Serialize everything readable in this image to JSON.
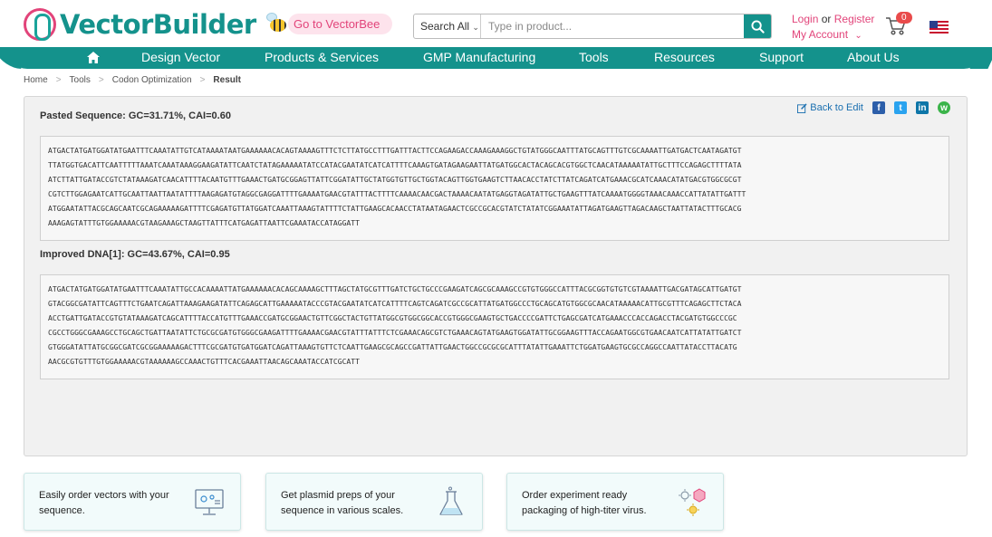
{
  "header": {
    "brand": "VectorBuilder",
    "vectorbee_label": "Go to VectorBee",
    "search_scope": "Search All",
    "search_placeholder": "Type in product...",
    "login": "Login",
    "or": "or",
    "register": "Register",
    "my_account": "My Account",
    "cart_count": "0"
  },
  "nav": {
    "items": [
      "Design Vector",
      "Products & Services",
      "GMP Manufacturing",
      "Tools",
      "Resources",
      "Support",
      "About Us"
    ]
  },
  "breadcrumb": {
    "items": [
      "Home",
      "Tools",
      "Codon Optimization"
    ],
    "current": "Result"
  },
  "result": {
    "back_to_edit": "Back to Edit",
    "pasted_title": "Pasted Sequence: GC=31.71%, CAI=0.60",
    "pasted_sequence": "ATGACTATGATGGATATGAATTTCAAATATTGTCATAAAATAATGAAAAAACACAGTAAAAGTTTCTCTTATGCCTTTGATTTACTTCCAGAAGACCAAAGAAAGGCTGTATGGGCAATTTATGCAGTTTGTCGCAAAATTGATGACTCAATAGATGT\nTTATGGTGACATTCAATTTTTAAATCAAATAAAGGAAGATATTCAATCTATAGAAAAATATCCATACGAATATCATCATTTTCAAAGTGATAGAAGAATTATGATGGCACTACAGCACGTGGCTCAACATAAAAATATTGCTTTCCAGAGCTTTTATA\nATCTTATTGATACCGTCTATAAAGATCAACATTTTACAATGTTTGAAACTGATGCGGAGTTATTCGGATATTGCTATGGTGTTGCTGGTACAGTTGGTGAAGTCTTAACACCTATCTTATCAGATCATGAAACGCATCAAACATATGACGTGGCGCGT\nCGTCTTGGAGAATCATTGCAATTAATTAATATTTTAAGAGATGTAGGCGAGGATTTTGAAAATGAACGTATTTACTTTTCAAAACAACGACTAAAACAATATGAGGTAGATATTGCTGAAGTTTATCAAAATGGGGTAAACAAACCATTATATTGATTT\nATGGAATATTACGCAGCAATCGCAGAAAAAGATTTTCGAGATGTTATGGATCAAATTAAAGTATTTTCTATTGAAGCACAACCTATAATAGAACTCGCCGCACGTATCTATATCGGAAATATTAGATGAAGTTAGACAAGCTAATTATACTTTGCACG\nAAAGAGTATTTGTGGAAAAACGTAAGAAAGCTAAGTTATTTCATGAGATTAATTCGAAATACCATAGGATT",
    "improved_title": "Improved DNA[1]: GC=43.67%, CAI=0.95",
    "improved_sequence": "ATGACTATGATGGATATGAATTTCAAATATTGCCACAAAATTATGAAAAAACACAGCAAAAGCTTTAGCTATGCGTTTGATCTGCTGCCCGAAGATCAGCGCAAAGCCGTGTGGGCCATTTACGCGGTGTGTCGTAAAATTGACGATAGCATTGATGT\nGTACGGCGATATTCAGTTTCTGAATCAGATTAAAGAAGATATTCAGAGCATTGAAAAATACCCGTACGAATATCATCATTTTCAGTCAGATCGCCGCATTATGATGGCCCTGCAGCATGTGGCGCAACATAAAAACATTGCGTTTCAGAGCTTCTACA\nACCTGATTGATACCGTGTATAAAGATCAGCATTTTACCATGTTTGAAACCGATGCGGAACTGTTCGGCTACTGTTATGGCGTGGCGGCACCGTGGGCGAAGTGCTGACCCCGATTCTGAGCGATCATGAAACCCACCAGACCTACGATGTGGCCCGC\nCGCCTGGGCGAAAGCCTGCAGCTGATTAATATTCTGCGCGATGTGGGCGAAGATTTTGAAAACGAACGTATTTATTTCTCGAAACAGCGTCTGAAACAGTATGAAGTGGATATTGCGGAAGTTTACCAGAATGGCGTGAACAATCATTATATTGATCT\nGTGGGATATTATGCGGCGATCGCGGAAAAAGACTTTCGCGATGTGATGGATCAGATTAAAGTGTTCTCAATTGAAGCGCAGCCGATTATTGAACTGGCCGCGCGCATTTATATTGAAATTCTGGATGAAGTGCGCCAGGCCAATTATACCTTACATG\nAACGCGTGTTTGTGGAAAAACGTAAAAAAGCCAAACTGTTTCACGAAATTAACAGCAAATACCATCGCATT"
  },
  "cards": [
    {
      "text": "Easily order vectors with your sequence.",
      "icon": "monitor-vector-icon"
    },
    {
      "text": "Get plasmid preps of your sequence in various scales.",
      "icon": "flask-icon"
    },
    {
      "text": "Order experiment ready packaging of high-titer virus.",
      "icon": "virus-icon"
    }
  ],
  "colors": {
    "brand_teal": "#14928c",
    "brand_pink": "#e2447a"
  }
}
